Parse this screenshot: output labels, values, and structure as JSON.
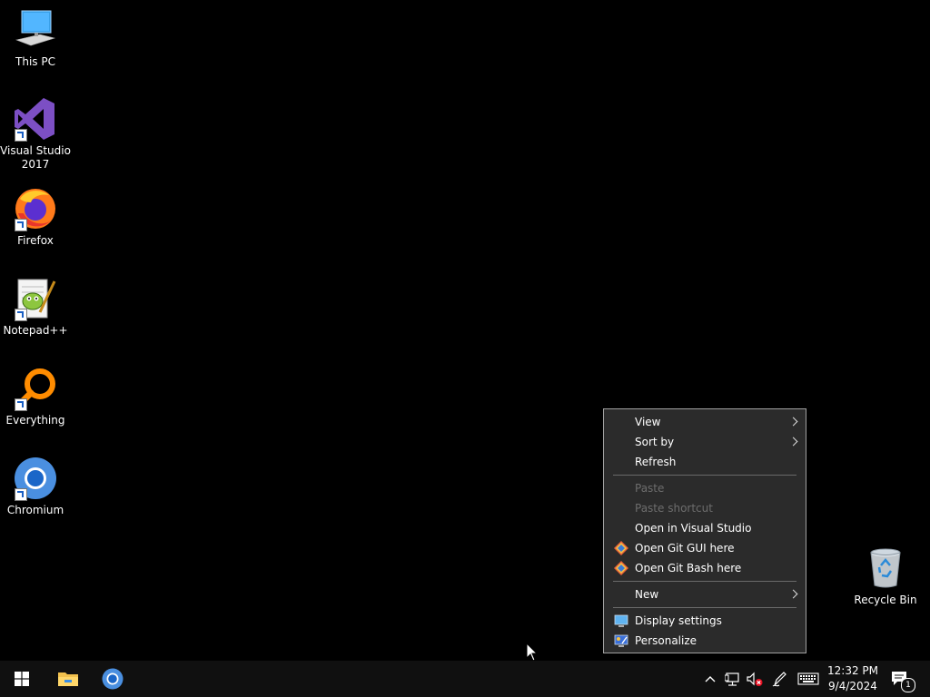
{
  "desktop": {
    "icons": [
      {
        "label": "This PC",
        "icon": "computer-icon"
      },
      {
        "label": "Visual Studio 2017",
        "icon": "visual-studio-icon"
      },
      {
        "label": "Firefox",
        "icon": "firefox-icon"
      },
      {
        "label": "Notepad++",
        "icon": "notepadpp-icon"
      },
      {
        "label": "Everything",
        "icon": "everything-search-icon"
      },
      {
        "label": "Chromium",
        "icon": "chromium-icon"
      }
    ],
    "recycle_bin": {
      "label": "Recycle Bin",
      "icon": "recycle-bin-icon"
    }
  },
  "context_menu": {
    "items": [
      {
        "label": "View",
        "submenu": true
      },
      {
        "label": "Sort by",
        "submenu": true
      },
      {
        "label": "Refresh"
      },
      {
        "label": "Paste",
        "disabled": true
      },
      {
        "label": "Paste shortcut",
        "disabled": true
      },
      {
        "label": "Open in Visual Studio"
      },
      {
        "label": "Open Git GUI here",
        "icon": "git-icon"
      },
      {
        "label": "Open Git Bash here",
        "icon": "git-icon"
      },
      {
        "label": "New",
        "submenu": true
      },
      {
        "label": "Display settings",
        "icon": "display-icon"
      },
      {
        "label": "Personalize",
        "icon": "personalize-icon"
      }
    ]
  },
  "taskbar": {
    "start": "windows-start-icon",
    "pinned": [
      "file-explorer-icon",
      "chromium-icon"
    ],
    "tray": [
      "chevron-up-icon",
      "network-icon",
      "volume-muted-icon",
      "pen-icon",
      "keyboard-icon"
    ],
    "clock": {
      "time": "12:32 PM",
      "date": "9/4/2024"
    },
    "notifications": {
      "count": "1"
    }
  },
  "colors": {
    "desktop_bg": "#000000",
    "menu_bg": "#2b2b2b",
    "menu_border": "#a0a0a0",
    "taskbar_bg": "#101010",
    "disabled_text": "#6d6d6d"
  }
}
